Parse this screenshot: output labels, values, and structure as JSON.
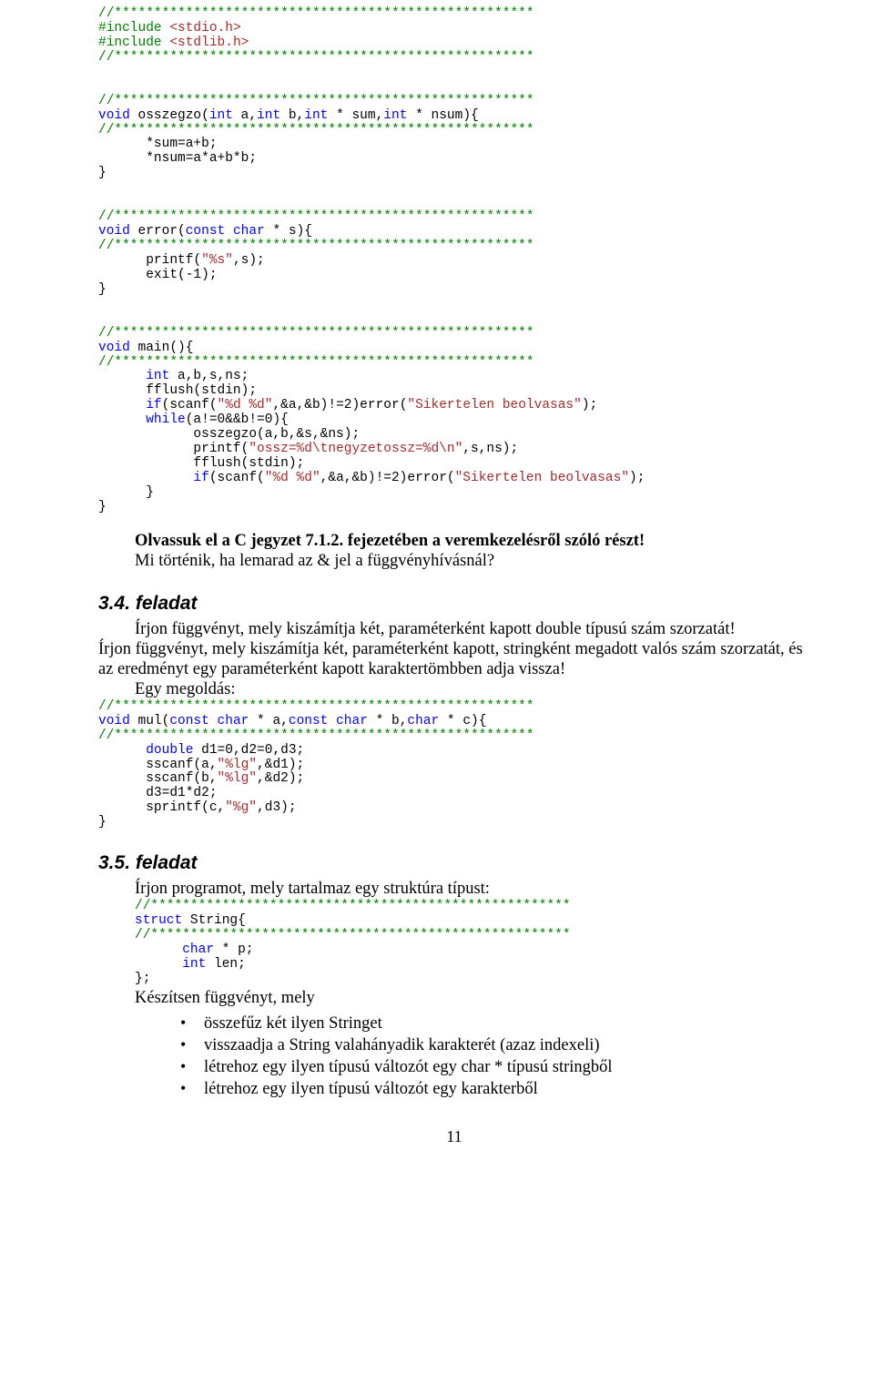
{
  "code1_l1": "//*****************************************************",
  "code1_l2_a": "#include ",
  "code1_l2_b": "<stdio.h>",
  "code1_l3_a": "#include ",
  "code1_l3_b": "<stdlib.h>",
  "code1_l4": "//*****************************************************",
  "code1_blank1": "",
  "code1_blank2": "",
  "code1_l5": "//*****************************************************",
  "code1_l6_a": "void",
  "code1_l6_b": " osszegzo(",
  "code1_l6_c": "int",
  "code1_l6_d": " a,",
  "code1_l6_e": "int",
  "code1_l6_f": " b,",
  "code1_l6_g": "int",
  "code1_l6_h": " * sum,",
  "code1_l6_i": "int",
  "code1_l6_j": " * nsum){",
  "code1_l7": "//*****************************************************",
  "code1_l8": "      *sum=a+b;",
  "code1_l9": "      *nsum=a*a+b*b;",
  "code1_l10": "}",
  "code1_blank3": "",
  "code1_blank4": "",
  "code1_l11": "//*****************************************************",
  "code1_l12_a": "void",
  "code1_l12_b": " error(",
  "code1_l12_c": "const",
  "code1_l12_d": " ",
  "code1_l12_e": "char",
  "code1_l12_f": " * s){",
  "code1_l13": "//*****************************************************",
  "code1_l14_a": "      printf(",
  "code1_l14_b": "\"%s\"",
  "code1_l14_c": ",s);",
  "code1_l15": "      exit(-1);",
  "code1_l16": "}",
  "code1_blank5": "",
  "code1_blank6": "",
  "code1_l17": "//*****************************************************",
  "code1_l18_a": "void",
  "code1_l18_b": " main(){",
  "code1_l19": "//*****************************************************",
  "code1_l20_a": "      ",
  "code1_l20_b": "int",
  "code1_l20_c": " a,b,s,ns;",
  "code1_l21": "      fflush(stdin);",
  "code1_l22_a": "      ",
  "code1_l22_b": "if",
  "code1_l22_c": "(scanf(",
  "code1_l22_d": "\"%d %d\"",
  "code1_l22_e": ",&a,&b)!=2)error(",
  "code1_l22_f": "\"Sikertelen beolvasas\"",
  "code1_l22_g": ");",
  "code1_l23_a": "      ",
  "code1_l23_b": "while",
  "code1_l23_c": "(a!=0&&b!=0){",
  "code1_l24": "            osszegzo(a,b,&s,&ns);",
  "code1_l25_a": "            printf(",
  "code1_l25_b": "\"ossz=%d\\tnegyzetossz=%d\\n\"",
  "code1_l25_c": ",s,ns);",
  "code1_l26": "            fflush(stdin);",
  "code1_l27_a": "            ",
  "code1_l27_b": "if",
  "code1_l27_c": "(scanf(",
  "code1_l27_d": "\"%d %d\"",
  "code1_l27_e": ",&a,&b)!=2)error(",
  "code1_l27_f": "\"Sikertelen beolvasas\"",
  "code1_l27_g": ");",
  "code1_l28": "      }",
  "code1_l29": "}",
  "para1_l1": "Olvassuk el a C jegyzet 7.1.2. fejezetében a veremkezelésről szóló részt!",
  "para1_l2": "Mi történik, ha lemarad az & jel a függvényhívásnál?",
  "sec34_title": "3.4. feladat",
  "sec34_p1": "Írjon függvényt, mely kiszámítja két, paraméterként kapott double típusú szám szorzatát!",
  "sec34_p2": "Írjon függvényt, mely kiszámítja két, paraméterként kapott, stringként megadott valós szám szorzatát, és az eredményt egy paraméterként kapott karaktertömbben adja vissza!",
  "sec34_p3": "Egy megoldás:",
  "code2_l1": "//*****************************************************",
  "code2_l2_a": "void",
  "code2_l2_b": " mul(",
  "code2_l2_c": "const",
  "code2_l2_d": " ",
  "code2_l2_e": "char",
  "code2_l2_f": " * a,",
  "code2_l2_g": "const",
  "code2_l2_h": " ",
  "code2_l2_i": "char",
  "code2_l2_j": " * b,",
  "code2_l2_k": "char",
  "code2_l2_l": " * c){",
  "code2_l3": "//*****************************************************",
  "code2_l4_a": "      ",
  "code2_l4_b": "double",
  "code2_l4_c": " d1=0,d2=0,d3;",
  "code2_l5_a": "      sscanf(a,",
  "code2_l5_b": "\"%lg\"",
  "code2_l5_c": ",&d1);",
  "code2_l6_a": "      sscanf(b,",
  "code2_l6_b": "\"%lg\"",
  "code2_l6_c": ",&d2);",
  "code2_l7": "      d3=d1*d2;",
  "code2_l8_a": "      sprintf(c,",
  "code2_l8_b": "\"%g\"",
  "code2_l8_c": ",d3);",
  "code2_l9": "}",
  "sec35_title": "3.5. feladat",
  "sec35_p1": "Írjon programot, mely tartalmaz egy struktúra típust:",
  "code3_l1": "//*****************************************************",
  "code3_l2_a": "struct",
  "code3_l2_b": " String{",
  "code3_l3": "//*****************************************************",
  "code3_l4_a": "      ",
  "code3_l4_b": "char",
  "code3_l4_c": " * p;",
  "code3_l5_a": "      ",
  "code3_l5_b": "int",
  "code3_l5_c": " len;",
  "code3_l6": "};",
  "sec35_p2": "Készítsen függvényt, mely",
  "b1": "összefűz két ilyen Stringet",
  "b2": "visszaadja a String valahányadik karakterét (azaz indexeli)",
  "b3": "létrehoz egy ilyen típusú változót egy char * típusú stringből",
  "b4": "létrehoz egy ilyen típusú változót egy karakterből",
  "page_num": "11"
}
